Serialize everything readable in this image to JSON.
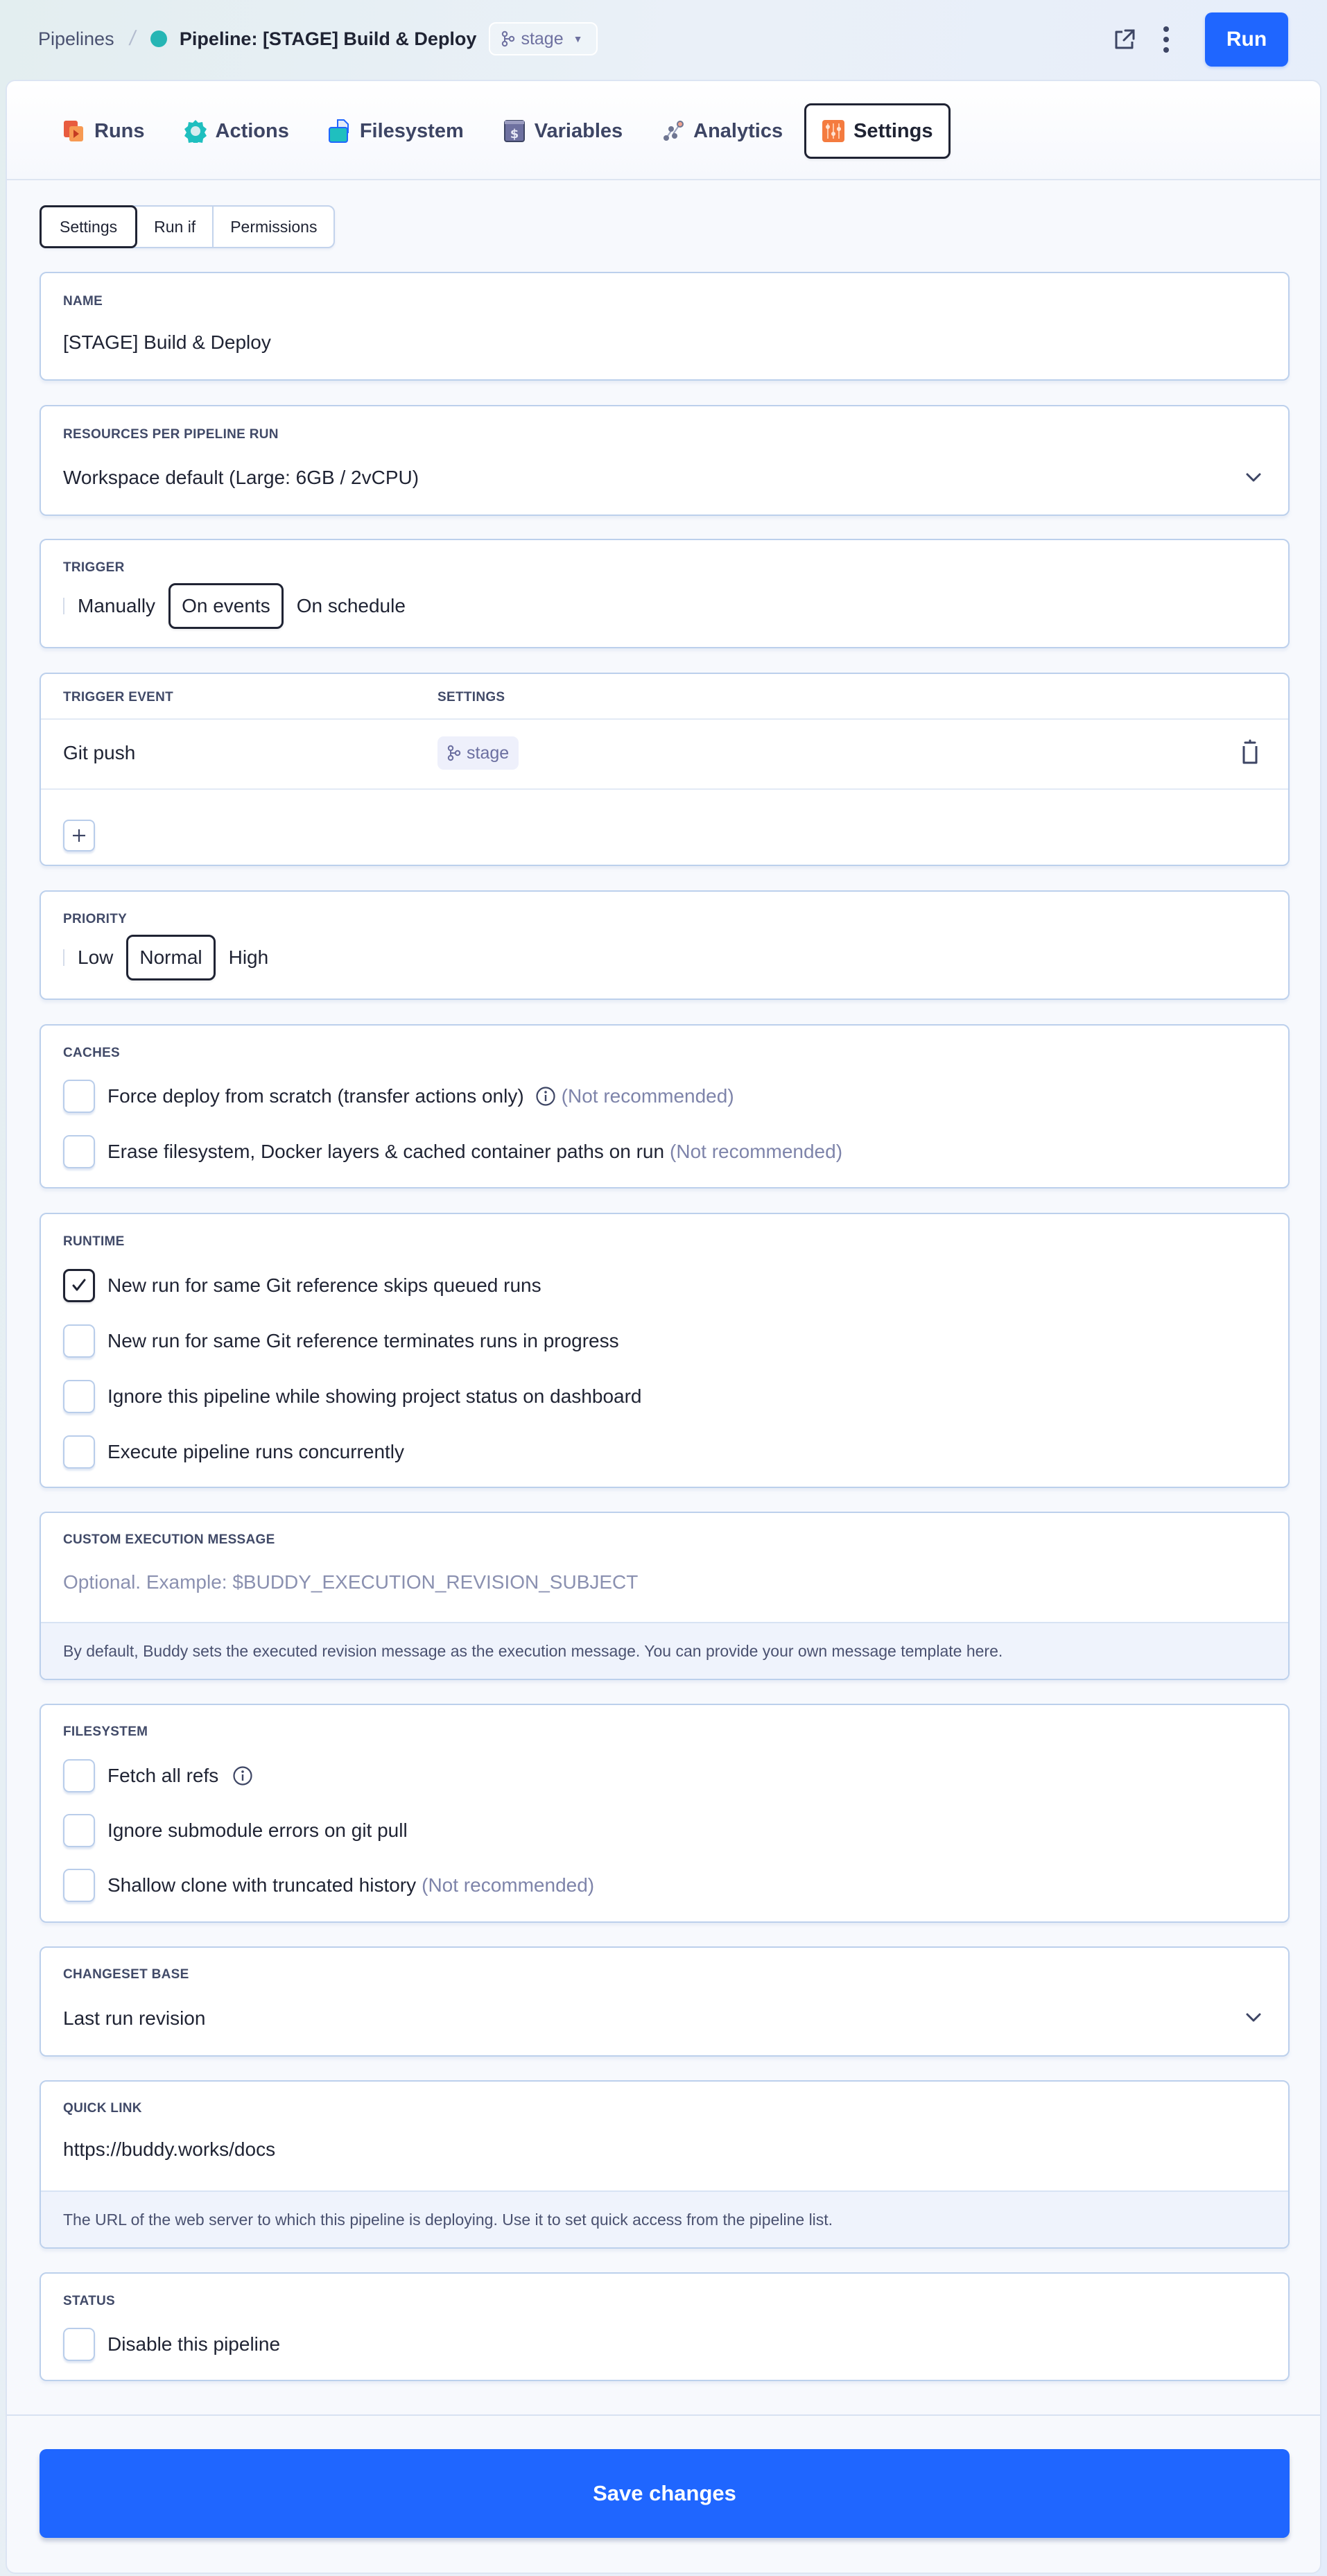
{
  "header": {
    "breadcrumb_root": "Pipelines",
    "breadcrumb_separator": "/",
    "pipeline_title": "Pipeline: [STAGE] Build & Deploy",
    "status_color": "#26b5b4",
    "branch": "stage",
    "open_external_icon": "external-link-icon",
    "more_icon": "vertical-dots-icon",
    "run_label": "Run"
  },
  "nav": {
    "tabs": [
      {
        "label": "Runs",
        "icon": "runs-icon",
        "active": false
      },
      {
        "label": "Actions",
        "icon": "actions-gear-icon",
        "active": false
      },
      {
        "label": "Filesystem",
        "icon": "filesystem-icon",
        "active": false
      },
      {
        "label": "Variables",
        "icon": "variables-dollar-icon",
        "active": false
      },
      {
        "label": "Analytics",
        "icon": "analytics-icon",
        "active": false
      },
      {
        "label": "Settings",
        "icon": "settings-sliders-icon",
        "active": true
      }
    ]
  },
  "subtabs": [
    {
      "label": "Settings",
      "active": true
    },
    {
      "label": "Run if",
      "active": false
    },
    {
      "label": "Permissions",
      "active": false
    }
  ],
  "name": {
    "label": "NAME",
    "value": "[STAGE] Build & Deploy"
  },
  "resources": {
    "label": "RESOURCES PER PIPELINE RUN",
    "value": "Workspace default (Large: 6GB / 2vCPU)"
  },
  "trigger": {
    "label": "TRIGGER",
    "options": [
      "Manually",
      "On events",
      "On schedule"
    ],
    "selected": "On events"
  },
  "trigger_events": {
    "headers": [
      "TRIGGER EVENT",
      "SETTINGS"
    ],
    "rows": [
      {
        "event": "Git push",
        "branch": "stage"
      }
    ],
    "add_label": "+"
  },
  "priority": {
    "label": "PRIORITY",
    "options": [
      "Low",
      "Normal",
      "High"
    ],
    "selected": "Normal"
  },
  "caches": {
    "label": "CACHES",
    "items": [
      {
        "label": "Force deploy from scratch (transfer actions only)",
        "info": true,
        "note": "(Not recommended)",
        "checked": false
      },
      {
        "label": "Erase filesystem, Docker layers & cached container paths on run",
        "info": false,
        "note": "(Not recommended)",
        "checked": false
      }
    ]
  },
  "runtime": {
    "label": "RUNTIME",
    "items": [
      {
        "label": "New run for same Git reference skips queued runs",
        "checked": true
      },
      {
        "label": "New run for same Git reference terminates runs in progress",
        "checked": false
      },
      {
        "label": "Ignore this pipeline while showing project status on dashboard",
        "checked": false
      },
      {
        "label": "Execute pipeline runs concurrently",
        "checked": false
      }
    ]
  },
  "custom_message": {
    "label": "CUSTOM EXECUTION MESSAGE",
    "value": "",
    "placeholder": "Optional. Example: $BUDDY_EXECUTION_REVISION_SUBJECT",
    "help": "By default, Buddy sets the executed revision message as the execution message. You can provide your own message template here."
  },
  "filesystem": {
    "label": "FILESYSTEM",
    "items": [
      {
        "label": "Fetch all refs",
        "info": true,
        "note": "",
        "checked": false
      },
      {
        "label": "Ignore submodule errors on git pull",
        "info": false,
        "note": "",
        "checked": false
      },
      {
        "label": "Shallow clone with truncated history",
        "info": false,
        "note": "(Not recommended)",
        "checked": false
      }
    ]
  },
  "changeset": {
    "label": "CHANGESET BASE",
    "value": "Last run revision"
  },
  "quick_link": {
    "label": "QUICK LINK",
    "value": "https://buddy.works/docs",
    "help": "The URL of the web server to which this pipeline is deploying. Use it to set quick access from the pipeline list."
  },
  "status": {
    "label": "STATUS",
    "items": [
      {
        "label": "Disable this pipeline",
        "checked": false
      }
    ]
  },
  "footer": {
    "save_label": "Save changes"
  },
  "colors": {
    "primary": "#1f66ff",
    "text": "#1f2333",
    "muted": "#7e84aa",
    "border": "#bcd0ec"
  }
}
